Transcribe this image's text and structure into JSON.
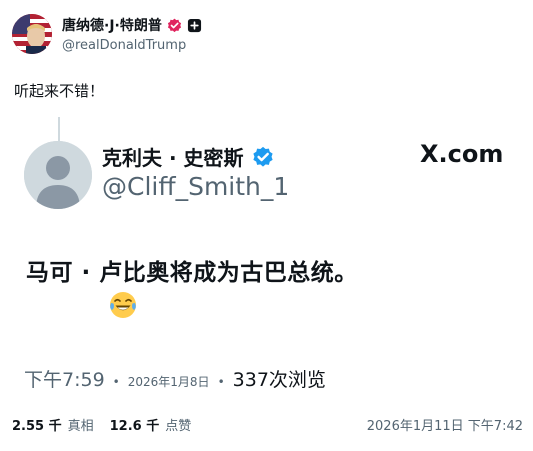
{
  "author": {
    "display_name": "唐纳德·J·特朗普",
    "handle": "@realDonaldTrump"
  },
  "post": {
    "text": "听起来不错！"
  },
  "quoted": {
    "display_name": "克利夫 · 史密斯",
    "handle": "@Cliff_Smith_1",
    "site_label": "X.com",
    "text": "马可 · 卢比奥将成为古巴总统。",
    "emoji": "😂",
    "time": "下午7:59",
    "date": "2026年1月8日",
    "views": "337次浏览"
  },
  "stats": {
    "reposts_value": "2.55 千",
    "reposts_label": "真相",
    "likes_value": "12.6 千",
    "likes_label": "点赞"
  },
  "post_datetime": "2026年1月11日 下午7:42",
  "colors": {
    "verified_blue": "#1d9bf0",
    "affiliate_pink": "#e0245e",
    "muted_text": "#536471"
  }
}
